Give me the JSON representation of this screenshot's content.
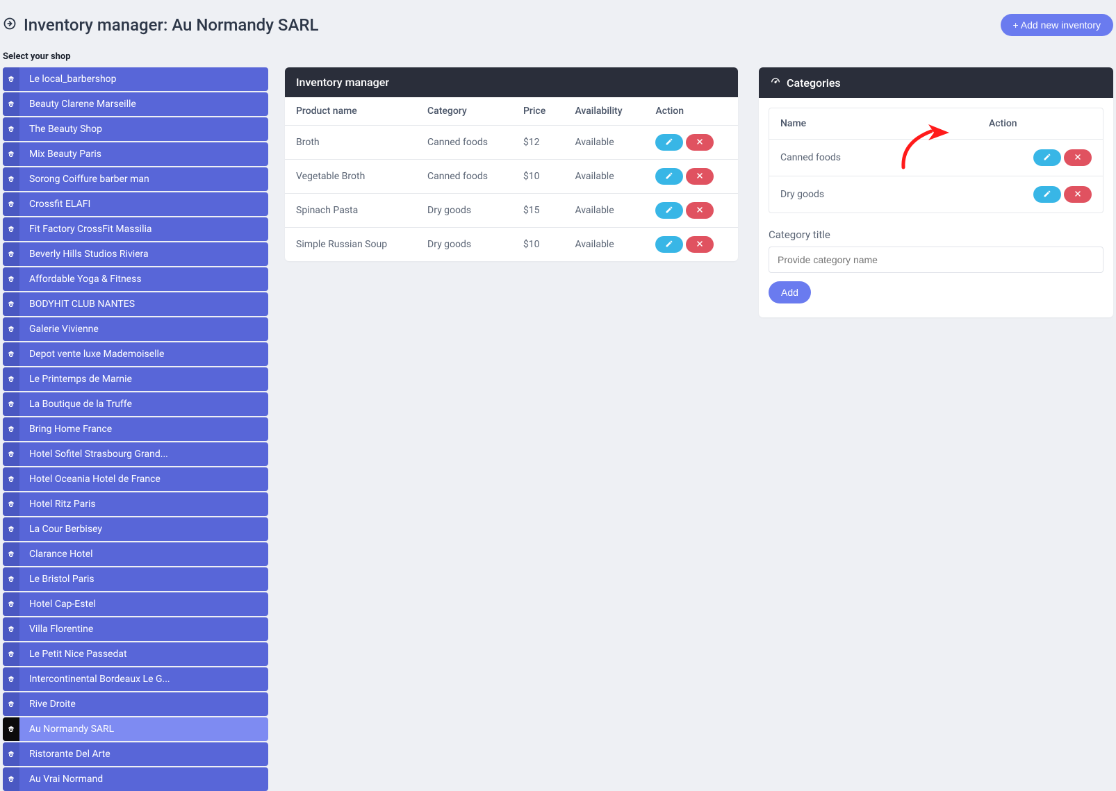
{
  "header": {
    "title": "Inventory manager: Au Normandy SARL",
    "add_button": "+ Add new inventory"
  },
  "select_shop_label": "Select your shop",
  "shops": [
    {
      "name": "Le local_barbershop",
      "active": false
    },
    {
      "name": "Beauty Clarene Marseille",
      "active": false
    },
    {
      "name": "The Beauty Shop",
      "active": false
    },
    {
      "name": "Mix Beauty Paris",
      "active": false
    },
    {
      "name": "Sorong Coiffure barber man",
      "active": false
    },
    {
      "name": "Crossfit ELAFI",
      "active": false
    },
    {
      "name": "Fit Factory CrossFit Massilia",
      "active": false
    },
    {
      "name": "Beverly Hills Studios Riviera",
      "active": false
    },
    {
      "name": "Affordable Yoga & Fitness",
      "active": false
    },
    {
      "name": "BODYHIT CLUB NANTES",
      "active": false
    },
    {
      "name": "Galerie Vivienne",
      "active": false
    },
    {
      "name": "Depot vente luxe Mademoiselle",
      "active": false
    },
    {
      "name": "Le Printemps de Marnie",
      "active": false
    },
    {
      "name": "La Boutique de la Truffe",
      "active": false
    },
    {
      "name": "Bring Home France",
      "active": false
    },
    {
      "name": "Hotel Sofitel Strasbourg Grand...",
      "active": false
    },
    {
      "name": "Hotel Oceania Hotel de France",
      "active": false
    },
    {
      "name": "Hotel Ritz Paris",
      "active": false
    },
    {
      "name": "La Cour Berbisey",
      "active": false
    },
    {
      "name": "Clarance Hotel",
      "active": false
    },
    {
      "name": "Le Bristol Paris",
      "active": false
    },
    {
      "name": "Hotel Cap-Estel",
      "active": false
    },
    {
      "name": "Villa Florentine",
      "active": false
    },
    {
      "name": "Le Petit Nice Passedat",
      "active": false
    },
    {
      "name": "Intercontinental Bordeaux Le G...",
      "active": false
    },
    {
      "name": "Rive Droite",
      "active": false
    },
    {
      "name": "Au Normandy SARL",
      "active": true
    },
    {
      "name": "Ristorante Del Arte",
      "active": false
    },
    {
      "name": "Au Vrai Normand",
      "active": false
    }
  ],
  "inventory": {
    "title": "Inventory manager",
    "columns": [
      "Product name",
      "Category",
      "Price",
      "Availability",
      "Action"
    ],
    "rows": [
      {
        "name": "Broth",
        "category": "Canned foods",
        "price": "$12",
        "availability": "Available"
      },
      {
        "name": "Vegetable Broth",
        "category": "Canned foods",
        "price": "$10",
        "availability": "Available"
      },
      {
        "name": "Spinach Pasta",
        "category": "Dry goods",
        "price": "$15",
        "availability": "Available"
      },
      {
        "name": "Simple Russian Soup",
        "category": "Dry goods",
        "price": "$10",
        "availability": "Available"
      }
    ]
  },
  "categories": {
    "title": "Categories",
    "columns": [
      "Name",
      "Action"
    ],
    "rows": [
      {
        "name": "Canned foods"
      },
      {
        "name": "Dry goods"
      }
    ],
    "form_label": "Category title",
    "placeholder": "Provide category name",
    "add_label": "Add"
  },
  "colors": {
    "primary": "#6a7bef",
    "sidebar": "#5866d8",
    "edit": "#38b6e6",
    "delete": "#e05260",
    "annotation": "#ff0000"
  }
}
